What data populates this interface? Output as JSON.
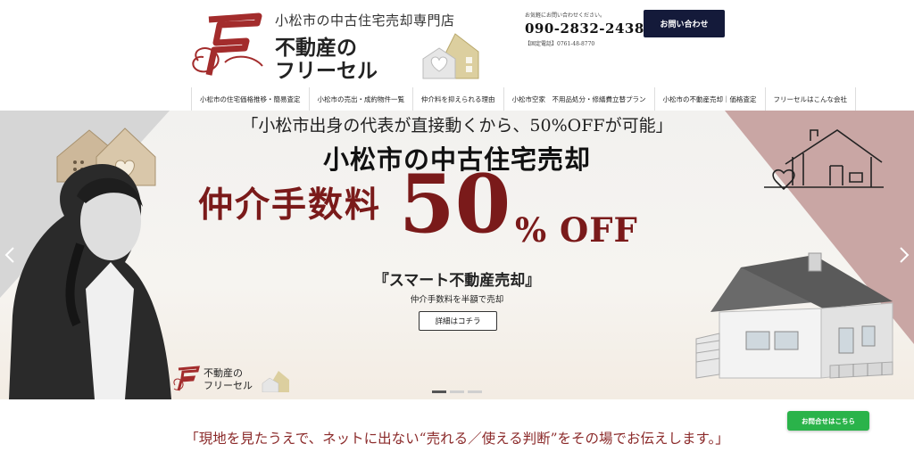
{
  "header": {
    "tagline": "小松市の中古住宅売却専門店",
    "brand_line1": "不動産の",
    "brand_line2": "フリーセル",
    "contact_small": "お気軽にお問い合わせください。",
    "phone": "090-2832-2438",
    "landline": "【固定電話】0761-48-8770",
    "contact_button": "お問い合わせ"
  },
  "nav": {
    "items": [
      {
        "label": "小松市の住宅価格推移・簡易査定"
      },
      {
        "label": "小松市の売出・成約物件一覧"
      },
      {
        "label": "仲介料を抑えられる理由"
      },
      {
        "label": "小松市空家　不用品処分・修繕費立替プラン"
      },
      {
        "label": "小松市の不動産売却｜価格査定"
      },
      {
        "label": "フリーセルはこんな会社"
      }
    ]
  },
  "hero": {
    "catch": "「小松市出身の代表が直接動くから、50%OFFが可能」",
    "title": "小松市の中古住宅売却",
    "fee_label": "仲介手数料",
    "fifty": "50",
    "off": "% OFF",
    "smart": "『スマート不動産売却』",
    "half": "仲介手数料を半額で売却",
    "detail_button": "詳細はコチラ",
    "mini_logo_line1": "不動産の",
    "mini_logo_line2": "フリーセル",
    "active_slide": 1,
    "slide_count": 3
  },
  "bottom": {
    "message": "「現地を見たうえで、ネットに出ない“売れる／使える判断”をその場でお伝えします。」",
    "green_button": "お問合せはこちら"
  },
  "colors": {
    "brand_red": "#7a1a1a",
    "navy": "#141a3a",
    "green": "#2ab34a",
    "accent_mauve": "#c9a6a4"
  },
  "icons": {
    "logo": "F-monogram-logo",
    "house": "house-heart-icon",
    "arrow_left": "chevron-left-icon",
    "arrow_right": "chevron-right-icon"
  }
}
